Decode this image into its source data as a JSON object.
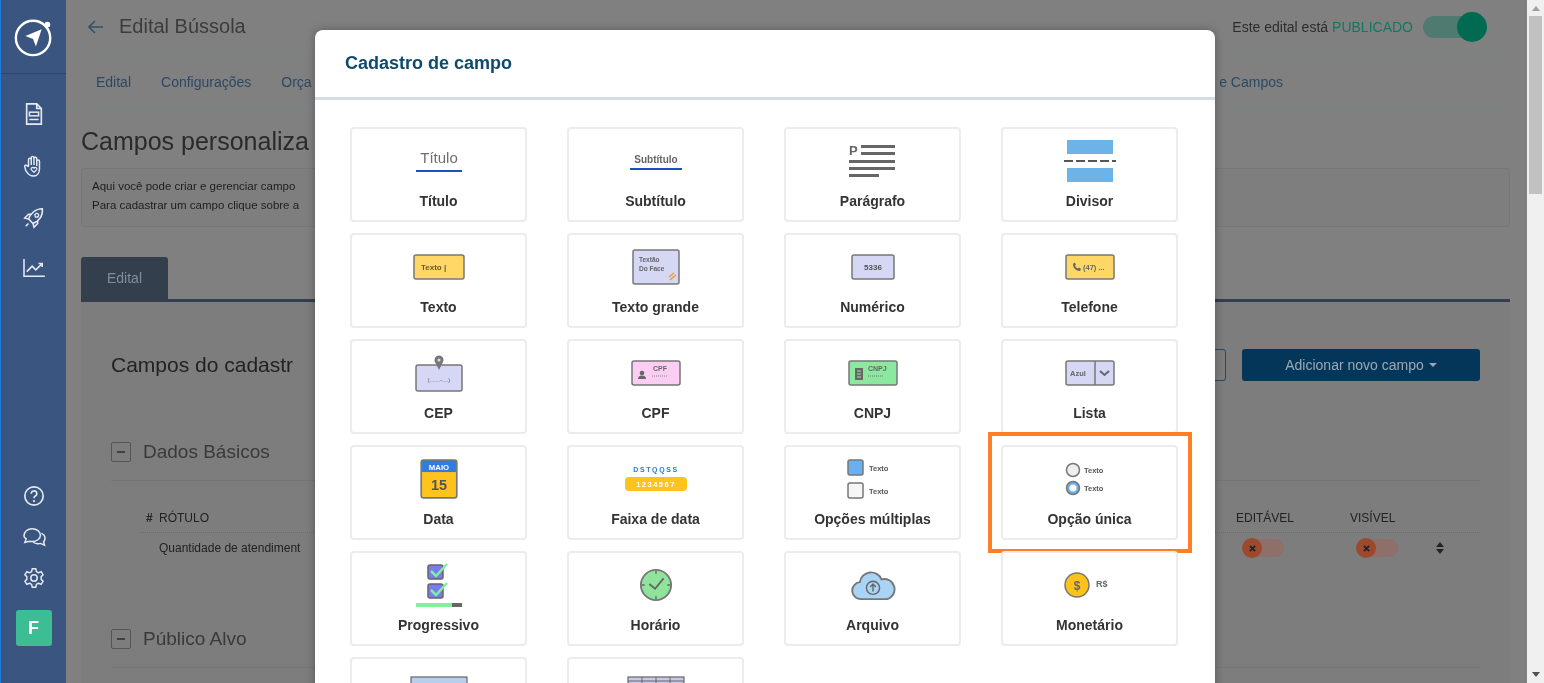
{
  "sidebar": {
    "avatar": "F"
  },
  "header": {
    "title": "Edital Bússola",
    "status_prefix": "Este edital está",
    "status": "PUBLICADO",
    "publish_switch": {
      "on": true
    }
  },
  "nav": {
    "tabs": [
      "Edital",
      "Configurações",
      "Orça"
    ],
    "right_tab": "e Campos"
  },
  "page": {
    "title": "Campos personaliza",
    "info_lines": [
      "Aqui você pode criar e gerenciar campo",
      "Para cadastrar um campo clique sobre a"
    ],
    "tabs": [
      {
        "label": "Edital",
        "selected": true
      }
    ],
    "section_title": "Campos do cadastr",
    "add_button": "Adicionar novo campo",
    "groups": [
      {
        "title": "Dados Básicos",
        "expanded": true,
        "columns": [
          "#",
          "RÓTULO",
          "EDITÁVEL",
          "VISÍVEL"
        ],
        "rows": [
          {
            "label": "Quantidade de atendiment",
            "editable": false,
            "visible": false
          }
        ]
      },
      {
        "title": "Público Alvo",
        "expanded": true
      }
    ]
  },
  "modal": {
    "title": "Cadastro de campo",
    "fields": [
      {
        "label": "Título",
        "kind": "titulo",
        "preview": [
          "Título"
        ],
        "highlighted": false
      },
      {
        "label": "Subtítulo",
        "kind": "subtitulo",
        "preview": [
          "Subtítulo"
        ],
        "highlighted": false
      },
      {
        "label": "Parágrafo",
        "kind": "paragrafo",
        "preview": [
          "P"
        ],
        "highlighted": false
      },
      {
        "label": "Divisor",
        "kind": "divisor",
        "highlighted": false
      },
      {
        "label": "Texto",
        "kind": "texto",
        "preview": [
          "Texto |"
        ],
        "highlighted": false
      },
      {
        "label": "Texto grande",
        "kind": "textogrande",
        "preview": [
          "Textão",
          "Do Face"
        ],
        "highlighted": false
      },
      {
        "label": "Numérico",
        "kind": "numerico",
        "preview": [
          "5336"
        ],
        "highlighted": false
      },
      {
        "label": "Telefone",
        "kind": "telefone",
        "preview": [
          "(47) ..."
        ],
        "highlighted": false
      },
      {
        "label": "CEP",
        "kind": "cep",
        "preview": [
          "(.......-....)"
        ],
        "highlighted": false
      },
      {
        "label": "CPF",
        "kind": "cpf",
        "preview": [
          "CPF"
        ],
        "highlighted": false
      },
      {
        "label": "CNPJ",
        "kind": "cnpj",
        "preview": [
          "CNPJ"
        ],
        "highlighted": false
      },
      {
        "label": "Lista",
        "kind": "lista",
        "preview": [
          "Azul"
        ],
        "highlighted": false
      },
      {
        "label": "Data",
        "kind": "data",
        "preview": [
          "MAIO",
          "15"
        ],
        "highlighted": false
      },
      {
        "label": "Faixa de data",
        "kind": "faixa",
        "preview": [
          "DSTQQSS",
          "1234567"
        ],
        "highlighted": false
      },
      {
        "label": "Opções múltiplas",
        "kind": "multi",
        "preview": [
          "Texto",
          "Texto"
        ],
        "highlighted": false
      },
      {
        "label": "Opção única",
        "kind": "unica",
        "preview": [
          "Texto",
          "Texto"
        ],
        "highlighted": true
      },
      {
        "label": "Progressivo",
        "kind": "progressivo",
        "highlighted": false
      },
      {
        "label": "Horário",
        "kind": "horario",
        "highlighted": false
      },
      {
        "label": "Arquivo",
        "kind": "arquivo",
        "highlighted": false
      },
      {
        "label": "Monetário",
        "kind": "monetario",
        "preview": [
          "$",
          "R$"
        ],
        "highlighted": false
      },
      {
        "kind": "partial-form",
        "highlighted": false
      },
      {
        "kind": "partial-table",
        "highlighted": false
      }
    ]
  }
}
